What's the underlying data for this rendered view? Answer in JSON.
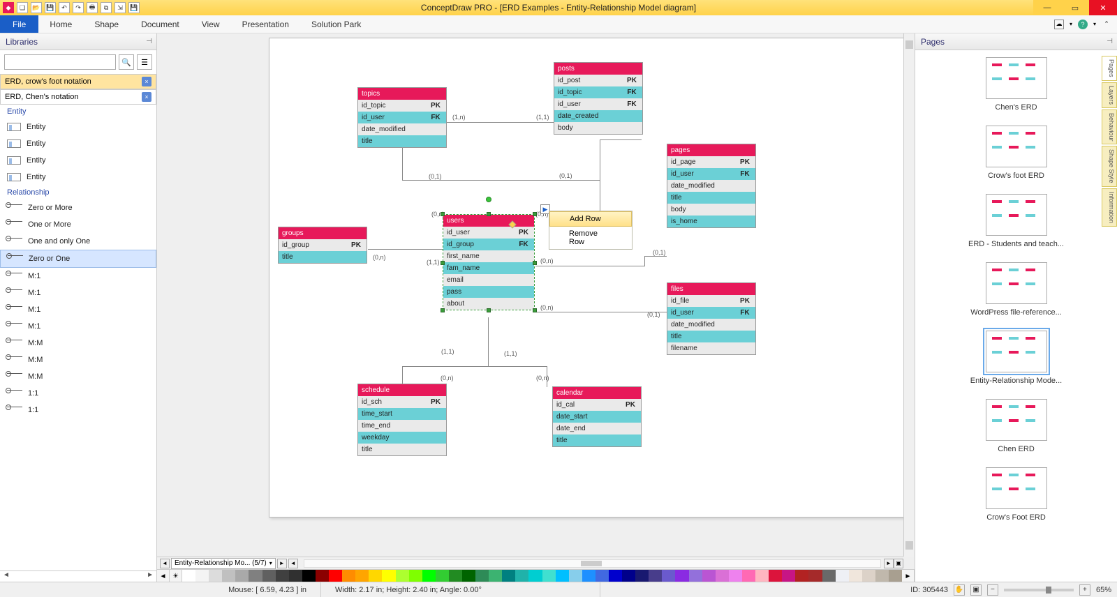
{
  "title": "ConceptDraw PRO - [ERD Examples - Entity-Relationship Model diagram]",
  "menu": {
    "file": "File",
    "items": [
      "Home",
      "Shape",
      "Document",
      "View",
      "Presentation",
      "Solution Park"
    ]
  },
  "libraries": {
    "header": "Libraries",
    "search_placeholder": "",
    "categories": [
      {
        "label": "ERD, crow's foot notation",
        "active": true
      },
      {
        "label": "ERD, Chen's notation",
        "active": false
      }
    ],
    "section_entity": "Entity",
    "entity_items": [
      "Entity",
      "Entity",
      "Entity",
      "Entity"
    ],
    "section_relationship": "Relationship",
    "relationship_items": [
      "Zero or More",
      "One or More",
      "One and only One",
      "Zero or One",
      "M:1",
      "M:1",
      "M:1",
      "M:1",
      "M:M",
      "M:M",
      "M:M",
      "1:1",
      "1:1"
    ]
  },
  "canvas": {
    "context_menu": {
      "add": "Add Row",
      "remove": "Remove Row"
    },
    "labels": {
      "l_11_a": "(1,n)",
      "l_11_b": "(1,1)",
      "l_topic_users": "(0,1)",
      "l_users_top": "(0,n)",
      "l_groups_r": "(0,n)",
      "l_groups_users": "(1,1)",
      "l_users_pages": "(0,n)",
      "l_pages": "(0,1)",
      "l_users_files": "(0,n)",
      "l_files": "(0,1)",
      "l_sch_a": "(1,1)",
      "l_sch_b": "(1,1)",
      "l_sch_top": "(0,n)",
      "l_cal": "(0,n)"
    },
    "entities": {
      "topics": {
        "name": "topics",
        "rows": [
          {
            "n": "id_topic",
            "k": "PK"
          },
          {
            "n": "id_user",
            "k": "FK"
          },
          {
            "n": "date_modified",
            "k": ""
          },
          {
            "n": "title",
            "k": ""
          }
        ]
      },
      "posts": {
        "name": "posts",
        "rows": [
          {
            "n": "id_post",
            "k": "PK"
          },
          {
            "n": "id_topic",
            "k": "FK"
          },
          {
            "n": "id_user",
            "k": "FK"
          },
          {
            "n": "date_created",
            "k": ""
          },
          {
            "n": "body",
            "k": ""
          }
        ]
      },
      "pages": {
        "name": "pages",
        "rows": [
          {
            "n": "id_page",
            "k": "PK"
          },
          {
            "n": "id_user",
            "k": "FK"
          },
          {
            "n": "date_modified",
            "k": ""
          },
          {
            "n": "title",
            "k": ""
          },
          {
            "n": "body",
            "k": ""
          },
          {
            "n": "is_home",
            "k": ""
          }
        ]
      },
      "groups": {
        "name": "groups",
        "rows": [
          {
            "n": "id_group",
            "k": "PK"
          },
          {
            "n": "title",
            "k": ""
          }
        ]
      },
      "users": {
        "name": "users",
        "rows": [
          {
            "n": "id_user",
            "k": "PK"
          },
          {
            "n": "id_group",
            "k": "FK"
          },
          {
            "n": "first_name",
            "k": ""
          },
          {
            "n": "fam_name",
            "k": ""
          },
          {
            "n": "email",
            "k": ""
          },
          {
            "n": "pass",
            "k": ""
          },
          {
            "n": "about",
            "k": ""
          }
        ]
      },
      "files": {
        "name": "files",
        "rows": [
          {
            "n": "id_file",
            "k": "PK"
          },
          {
            "n": "id_user",
            "k": "FK"
          },
          {
            "n": "date_modified",
            "k": ""
          },
          {
            "n": "title",
            "k": ""
          },
          {
            "n": "filename",
            "k": ""
          }
        ]
      },
      "schedule": {
        "name": "schedule",
        "rows": [
          {
            "n": "id_sch",
            "k": "PK"
          },
          {
            "n": "time_start",
            "k": ""
          },
          {
            "n": "time_end",
            "k": ""
          },
          {
            "n": "weekday",
            "k": ""
          },
          {
            "n": "title",
            "k": ""
          }
        ]
      },
      "calendar": {
        "name": "calendar",
        "rows": [
          {
            "n": "id_cal",
            "k": "PK"
          },
          {
            "n": "date_start",
            "k": ""
          },
          {
            "n": "date_end",
            "k": ""
          },
          {
            "n": "title",
            "k": ""
          }
        ]
      }
    },
    "page_tab": "Entity-Relationship Mo...  (5/7)"
  },
  "swatches": [
    "#ffffff",
    "#f4f4f4",
    "#dcdcdc",
    "#c0c0c0",
    "#a9a9a9",
    "#808080",
    "#606060",
    "#404040",
    "#303030",
    "#000000",
    "#8b0000",
    "#ff0000",
    "#ff8c00",
    "#ffa500",
    "#ffd700",
    "#ffff00",
    "#adff2f",
    "#7fff00",
    "#00ff00",
    "#32cd32",
    "#228b22",
    "#006400",
    "#2e8b57",
    "#3cb371",
    "#008080",
    "#20b2aa",
    "#00ced1",
    "#40e0d0",
    "#00bfff",
    "#87ceeb",
    "#1e90ff",
    "#4169e1",
    "#0000cd",
    "#00008b",
    "#191970",
    "#483d8b",
    "#6a5acd",
    "#8a2be2",
    "#9370db",
    "#ba55d3",
    "#da70d6",
    "#ee82ee",
    "#ff69b4",
    "#ffb6c1",
    "#dc143c",
    "#c71585",
    "#b22222",
    "#a52a2a",
    "#696969",
    "#eef0f5",
    "#f0e6dc",
    "#dcd2c8",
    "#c0b8ac",
    "#a89f90"
  ],
  "pages_panel": {
    "header": "Pages",
    "thumbs": [
      {
        "label": "Chen's ERD",
        "selected": false
      },
      {
        "label": "Crow's foot ERD",
        "selected": false
      },
      {
        "label": "ERD - Students and teach...",
        "selected": false
      },
      {
        "label": "WordPress file-reference...",
        "selected": false
      },
      {
        "label": "Entity-Relationship Mode...",
        "selected": true
      },
      {
        "label": "Chen ERD",
        "selected": false
      },
      {
        "label": "Crow's Foot ERD",
        "selected": false
      }
    ]
  },
  "side_tabs": [
    "Pages",
    "Layers",
    "Behaviour",
    "Shape Style",
    "Information"
  ],
  "status": {
    "mouse": "Mouse: [ 6.59, 4.23 ] in",
    "dims": "Width: 2.17 in;   Height: 2.40 in;   Angle: 0.00°",
    "id": "ID: 305443",
    "zoom": "65%"
  }
}
